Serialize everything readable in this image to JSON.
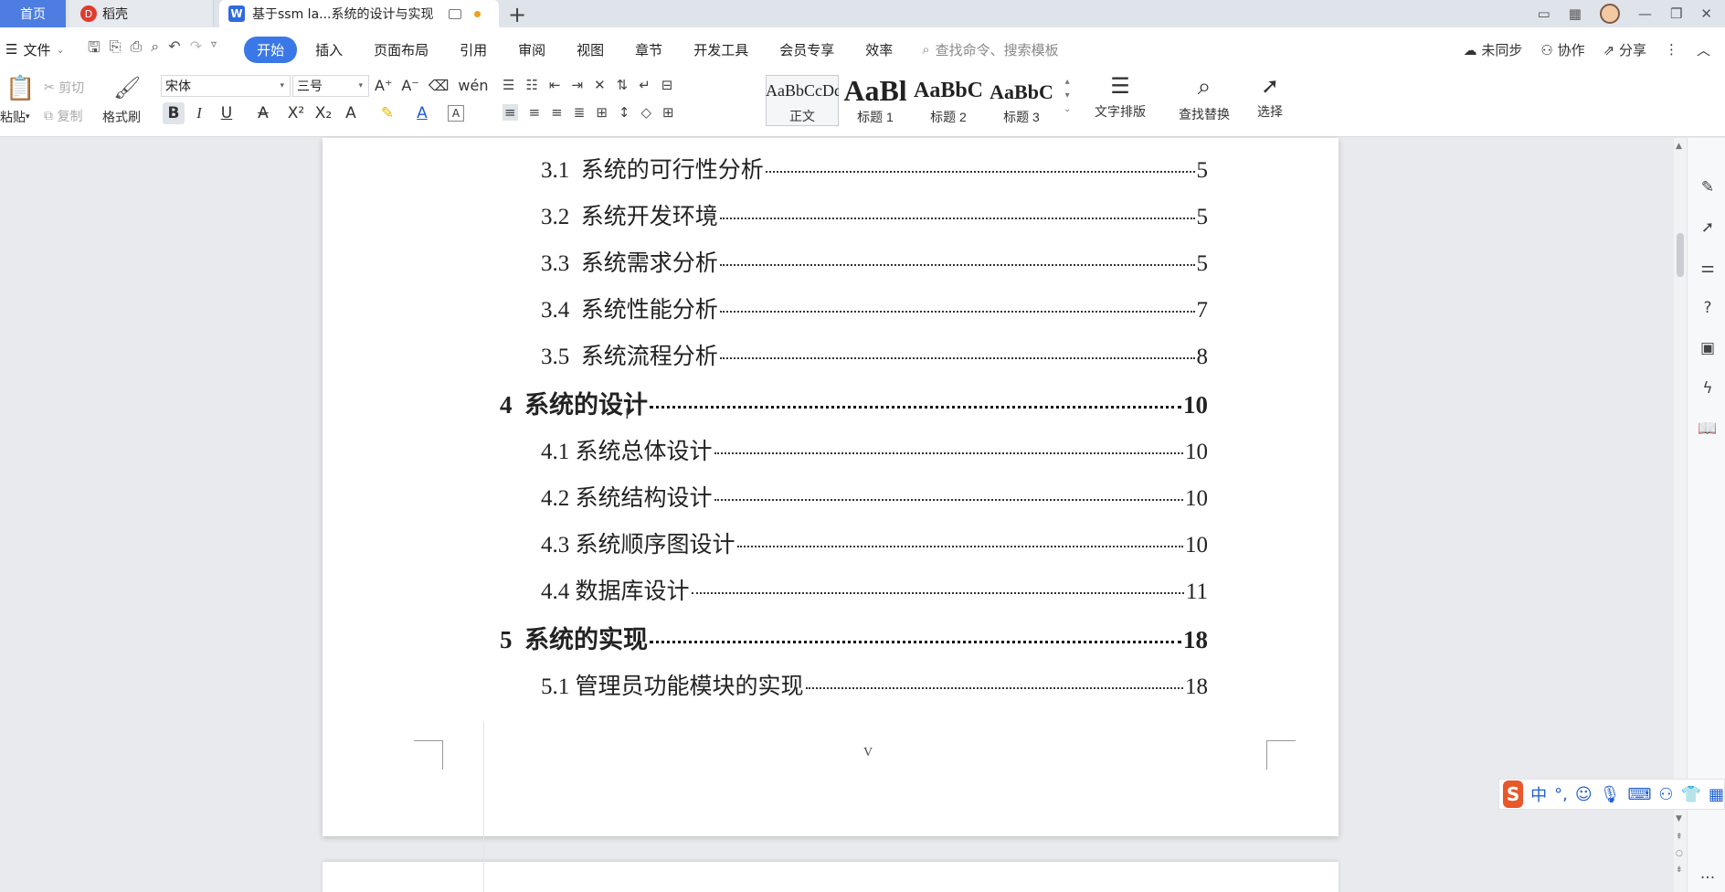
{
  "titlebar": {
    "home_tab": "首页",
    "daoke_tab": "稻壳",
    "doc_tab": "基于ssm la...系统的设计与实现",
    "new_tab_symbol": "+",
    "window_controls": [
      "—",
      "❐",
      "✕"
    ]
  },
  "menubar": {
    "file_label": "文件",
    "tabs": [
      "开始",
      "插入",
      "页面布局",
      "引用",
      "审阅",
      "视图",
      "章节",
      "开发工具",
      "会员专享",
      "效率"
    ],
    "active_tab": "开始",
    "search_placeholder": "查找命令、搜索模板",
    "sync_label": "未同步",
    "collab_label": "协作",
    "share_label": "分享"
  },
  "ribbon": {
    "paste_label": "粘贴",
    "cut_label": "剪切",
    "copy_label": "复制",
    "format_painter_label": "格式刷",
    "font_name": "宋体",
    "font_size": "三号",
    "styles": [
      {
        "sample": "AaBbCcDd",
        "caption": "正文"
      },
      {
        "sample": "AaBl",
        "caption": "标题 1"
      },
      {
        "sample": "AaBbC",
        "caption": "标题 2"
      },
      {
        "sample": "AaBbC",
        "caption": "标题 3"
      }
    ],
    "text_layout_label": "文字排版",
    "find_replace_label": "查找替换",
    "select_label": "选择"
  },
  "toc": [
    {
      "num": "3.1  ",
      "title": "系统的可行性分析",
      "page": "5",
      "level": 2
    },
    {
      "num": "3.2  ",
      "title": "系统开发环境",
      "page": "5",
      "level": 2
    },
    {
      "num": "3.3  ",
      "title": "系统需求分析",
      "page": "5",
      "level": 2
    },
    {
      "num": "3.4  ",
      "title": "系统性能分析",
      "page": "7",
      "level": 2
    },
    {
      "num": "3.5  ",
      "title": "系统流程分析",
      "page": "8",
      "level": 2
    },
    {
      "num": "4  ",
      "title": "系统的设计",
      "page": "10",
      "level": 1
    },
    {
      "num": "4.1 ",
      "title": "系统总体设计",
      "page": "10",
      "level": 2
    },
    {
      "num": "4.2 ",
      "title": "系统结构设计",
      "page": "10",
      "level": 2
    },
    {
      "num": "4.3 ",
      "title": "系统顺序图设计",
      "page": "10",
      "level": 2
    },
    {
      "num": "4.4 ",
      "title": "数据库设计",
      "page": "11",
      "level": 2
    },
    {
      "num": "5  ",
      "title": "系统的实现",
      "page": "18",
      "level": 1
    },
    {
      "num": "5.1 ",
      "title": "管理员功能模块的实现",
      "page": "18",
      "level": 2
    }
  ],
  "page_footer_number": "V",
  "ime": {
    "mode": "中",
    "punct": "°,"
  }
}
